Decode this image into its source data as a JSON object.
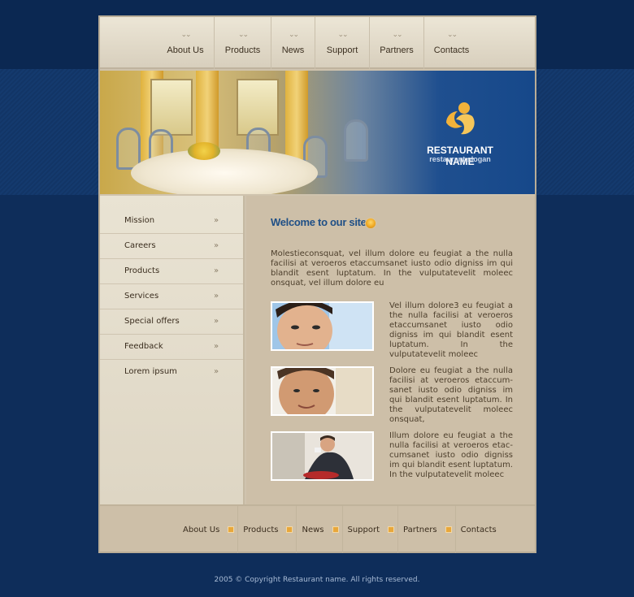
{
  "top_nav": [
    {
      "label": "About Us"
    },
    {
      "label": "Products"
    },
    {
      "label": "News"
    },
    {
      "label": "Support"
    },
    {
      "label": "Partners"
    },
    {
      "label": "Contacts"
    }
  ],
  "hero": {
    "restaurant_name": "RESTAURANT NAME",
    "slogan": "restaurant slogan"
  },
  "sidebar": {
    "items": [
      {
        "label": "Mission"
      },
      {
        "label": "Careers"
      },
      {
        "label": "Products"
      },
      {
        "label": "Services"
      },
      {
        "label": "Special offers"
      },
      {
        "label": "Feedback"
      },
      {
        "label": "Lorem ipsum"
      }
    ],
    "arrow": "»"
  },
  "main": {
    "welcome_title": "Welcome to our site",
    "intro": "Molestieconsquat, vel illum dolore eu feugiat a the nulla facilisi at veroeros etaccumsanet iusto odio digniss im qui blandit esent luptatum. In the vulputatevelit moleec onsquat, vel illum dolore eu",
    "rows": [
      {
        "text": "Vel illum dolore3 eu feugiat a the nulla facilisi at veroeros etaccumsanet iusto odio digniss im qui blandit esent luptatum. In the vulputatevelit moleec"
      },
      {
        "text": "Dolore eu feugiat a the nulla facilisi at veroeros etaccum-sanet iusto odio digniss im qui blandit esent luptatum. In the vulputatevelit moleec onsquat,"
      },
      {
        "text": "Illum dolore eu feugiat a the nulla facilisi at veroeros etac-cumsanet iusto odio digniss im qui blandit esent luptatum. In the vulputatevelit moleec"
      }
    ]
  },
  "footer_nav": [
    {
      "label": "About Us"
    },
    {
      "label": "Products"
    },
    {
      "label": "News"
    },
    {
      "label": "Support"
    },
    {
      "label": "Partners"
    },
    {
      "label": "Contacts"
    }
  ],
  "copyright": "2005 © Copyright Restaurant name. All rights reserved.",
  "colors": {
    "background": "#0c2a55",
    "panel": "#cdbfa8",
    "title_blue": "#1f4f86",
    "accent_orange": "#e8a73a"
  }
}
